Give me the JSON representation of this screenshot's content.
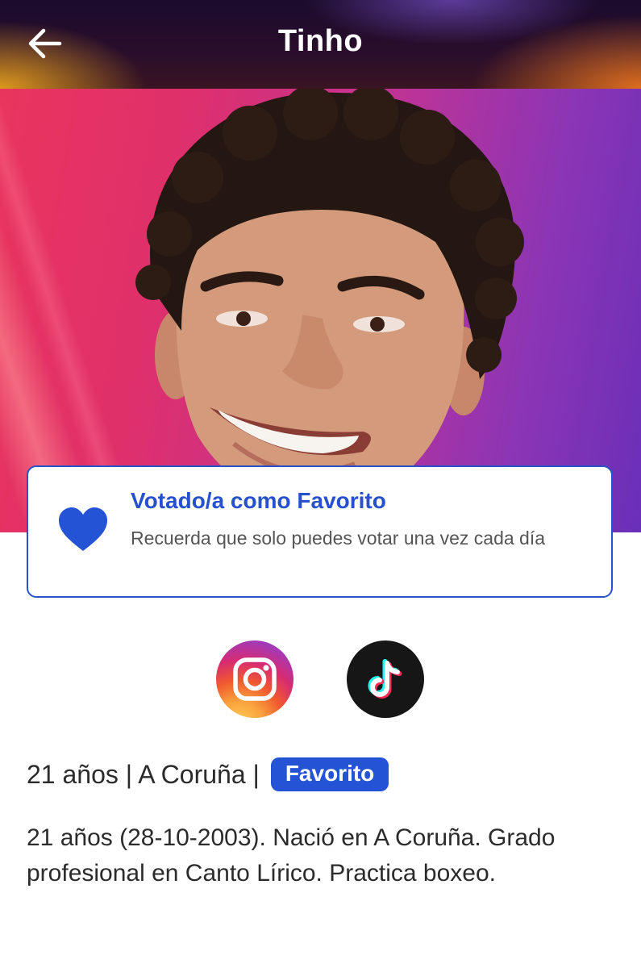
{
  "header": {
    "title": "Tinho",
    "back_icon": "arrow-left-icon"
  },
  "hero": {
    "image": "contestant-portrait"
  },
  "vote_card": {
    "icon": "heart-icon",
    "icon_color": "#2553d6",
    "title": "Votado/a como Favorito",
    "subtitle": "Recuerda que solo puedes votar una vez cada día"
  },
  "social": {
    "instagram_icon": "instagram-icon",
    "tiktok_icon": "tiktok-icon"
  },
  "info": {
    "summary": "21 años | A Coruña |",
    "badge": "Favorito",
    "badge_color": "#2553d6",
    "bio": "21 años (28-10-2003).  Nació en A Coruña. Grado profesional en Canto Lírico. Practica boxeo."
  }
}
